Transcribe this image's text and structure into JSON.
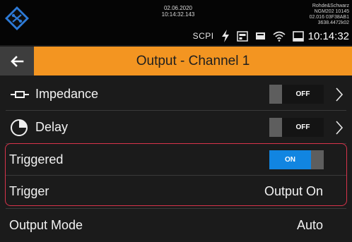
{
  "status_bar": {
    "date": "02.06.2020",
    "time_precise": "10:14:32.143",
    "device_lines": [
      "Rohde&Schwarz",
      "NGM202 10145",
      "02.016 03F38AB1",
      "3638.4472k02"
    ],
    "scpi_label": "SCPI",
    "clock": "10:14:32",
    "icons": [
      "lightning-icon",
      "usb-icon",
      "storage-icon",
      "wifi-icon",
      "screen-icon"
    ]
  },
  "title_bar": {
    "back_icon": "arrow-left-icon",
    "title": "Output - Channel 1",
    "background": "#f39521"
  },
  "rows": [
    {
      "label": "Impedance",
      "icon": "impedance-icon",
      "toggle": "OFF",
      "chevron": true
    },
    {
      "label": "Delay",
      "icon": "clock-icon",
      "toggle": "OFF",
      "chevron": true
    },
    {
      "label": "Triggered",
      "toggle": "ON"
    },
    {
      "label": "Trigger",
      "value": "Output On"
    },
    {
      "label": "Output Mode",
      "value": "Auto"
    }
  ],
  "colors": {
    "toggle_on": "#1185e1",
    "highlight_border": "#d8334b",
    "accent": "#f39521"
  }
}
